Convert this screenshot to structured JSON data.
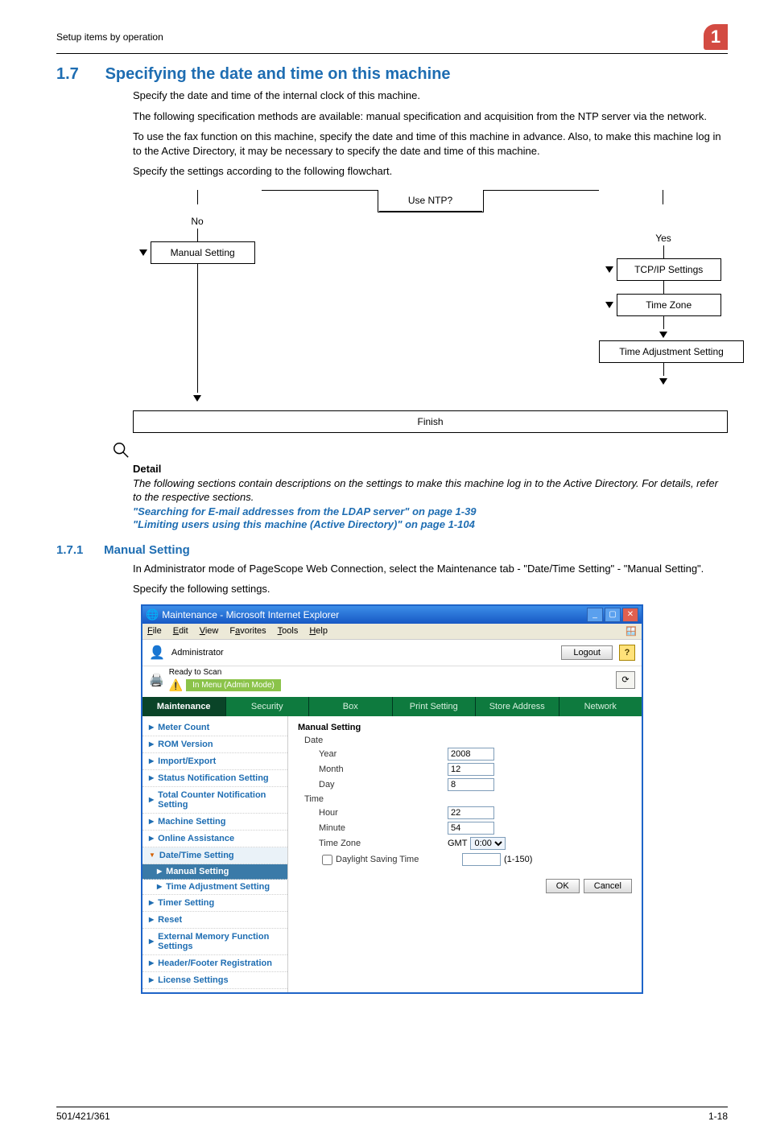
{
  "header": {
    "breadcrumb": "Setup items by operation",
    "chapter_badge": "1"
  },
  "section": {
    "number": "1.7",
    "title": "Specifying the date and time on this machine",
    "paragraphs": [
      "Specify the date and time of the internal clock of this machine.",
      "The following specification methods are available: manual specification and acquisition from the NTP server via the network.",
      "To use the fax function on this machine, specify the date and time of this machine in advance. Also, to make this machine log in to the Active Directory, it may be necessary to specify the date and time of this machine.",
      "Specify the settings according to the following flowchart."
    ]
  },
  "flowchart": {
    "decision": "Use NTP?",
    "no_label": "No",
    "yes_label": "Yes",
    "left_box": "Manual Setting",
    "right_boxes": [
      "TCP/IP Settings",
      "Time Zone",
      "Time Adjustment Setting"
    ],
    "finish": "Finish"
  },
  "detail": {
    "label": "Detail",
    "text": "The following sections contain descriptions on the settings to make this machine log in to the Active Directory. For details, refer to the respective sections.",
    "link1": "\"Searching for E-mail addresses from the LDAP server\" on page 1-39",
    "link2": "\"Limiting users using this machine (Active Directory)\" on page 1-104"
  },
  "subsection": {
    "number": "1.7.1",
    "title": "Manual Setting",
    "paragraphs": [
      "In Administrator mode of PageScope Web Connection, select the Maintenance tab - \"Date/Time Setting\" - \"Manual Setting\".",
      "Specify the following settings."
    ]
  },
  "ie": {
    "window_title": "Maintenance - Microsoft Internet Explorer",
    "menu": {
      "file": "File",
      "edit": "Edit",
      "view": "View",
      "favorites": "Favorites",
      "tools": "Tools",
      "help": "Help"
    },
    "admin_label": "Administrator",
    "logout": "Logout",
    "help": "?",
    "status_text": "Ready to Scan",
    "mode_strip": "In Menu (Admin Mode)",
    "tabs": [
      "Maintenance",
      "Security",
      "Box",
      "Print Setting",
      "Store Address",
      "Network"
    ],
    "active_tab_index": 0,
    "nav": {
      "items": [
        "Meter Count",
        "ROM Version",
        "Import/Export",
        "Status Notification Setting",
        "Total Counter Notification Setting",
        "Machine Setting",
        "Online Assistance"
      ],
      "expanded": "Date/Time Setting",
      "sub": [
        "Manual Setting",
        "Time Adjustment Setting"
      ],
      "active_sub_index": 0,
      "after": [
        "Timer Setting",
        "Reset",
        "External Memory Function Settings",
        "Header/Footer Registration",
        "License Settings"
      ]
    },
    "form": {
      "title": "Manual Setting",
      "date_label": "Date",
      "year_label": "Year",
      "year_value": "2008",
      "month_label": "Month",
      "month_value": "12",
      "day_label": "Day",
      "day_value": "8",
      "time_label": "Time",
      "hour_label": "Hour",
      "hour_value": "22",
      "minute_label": "Minute",
      "minute_value": "54",
      "tz_label": "Time Zone",
      "tz_prefix": "GMT",
      "tz_value": "0:00",
      "dst_label": "Daylight Saving Time",
      "dst_range": "(1-150)",
      "ok": "OK",
      "cancel": "Cancel"
    }
  },
  "footer": {
    "left": "501/421/361",
    "right": "1-18"
  }
}
